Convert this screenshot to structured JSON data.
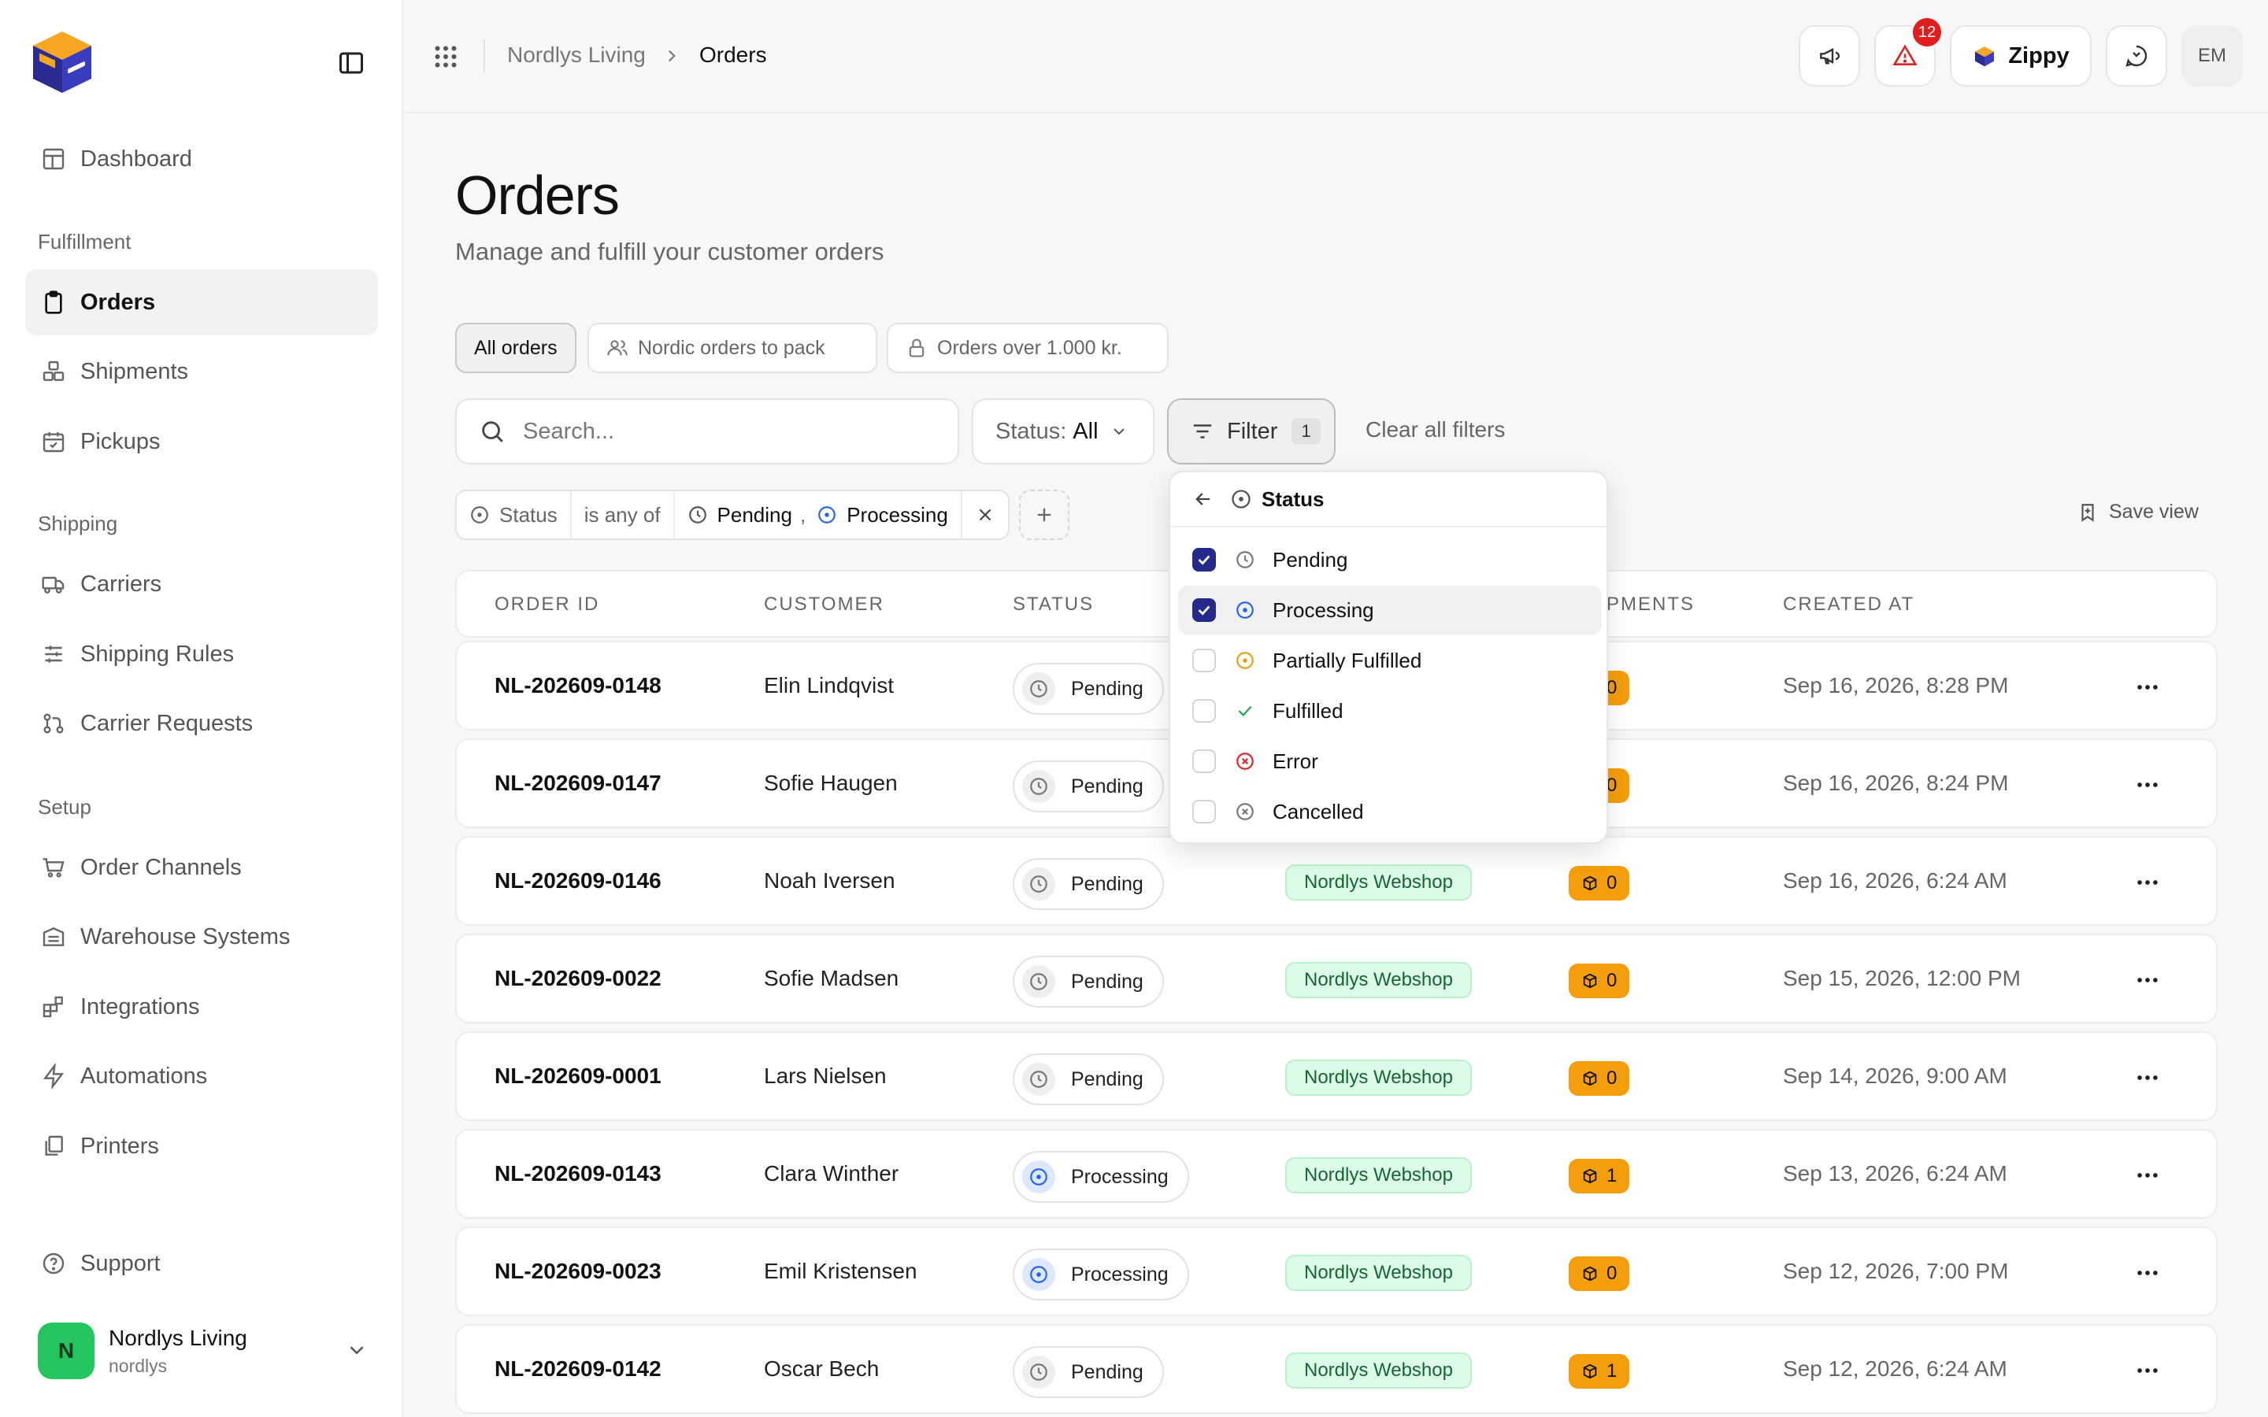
{
  "sidebar": {
    "items": [
      {
        "label": "Dashboard",
        "icon": "dashboard-icon"
      },
      {
        "label": "Orders",
        "icon": "clipboard-icon",
        "active": true
      },
      {
        "label": "Shipments",
        "icon": "boxes-icon"
      },
      {
        "label": "Pickups",
        "icon": "calendar-check-icon"
      },
      {
        "label": "Carriers",
        "icon": "truck-icon"
      },
      {
        "label": "Shipping Rules",
        "icon": "sliders-icon"
      },
      {
        "label": "Carrier Requests",
        "icon": "git-pull-icon"
      },
      {
        "label": "Order Channels",
        "icon": "cart-icon"
      },
      {
        "label": "Warehouse Systems",
        "icon": "warehouse-icon"
      },
      {
        "label": "Integrations",
        "icon": "blocks-icon"
      },
      {
        "label": "Automations",
        "icon": "zap-icon"
      },
      {
        "label": "Printers",
        "icon": "copy-icon"
      },
      {
        "label": "Support",
        "icon": "help-circle-icon"
      }
    ],
    "sections": {
      "fulfillment": "Fulfillment",
      "shipping": "Shipping",
      "setup": "Setup"
    },
    "account": {
      "initial": "N",
      "name": "Nordlys Living",
      "handle": "nordlys"
    }
  },
  "topbar": {
    "breadcrumb": {
      "parent": "Nordlys Living",
      "current": "Orders"
    },
    "alerts_count": "12",
    "assistant_label": "Zippy",
    "user_initials": "EM"
  },
  "page": {
    "title": "Orders",
    "subtitle": "Manage and fulfill your customer orders"
  },
  "views": [
    {
      "label": "All orders",
      "active": true
    },
    {
      "label": "Nordic orders to pack",
      "icon": "users-icon"
    },
    {
      "label": "Orders over 1.000 kr.",
      "icon": "lock-icon"
    }
  ],
  "toolbar": {
    "search_placeholder": "Search...",
    "status_label": "Status:",
    "status_value": "All",
    "filter_label": "Filter",
    "filter_count": "1",
    "clear_label": "Clear all filters",
    "save_view_label": "Save view"
  },
  "active_filter": {
    "field": "Status",
    "operator": "is any of",
    "value1": "Pending",
    "separator": ",",
    "value2": "Processing"
  },
  "table": {
    "headers": {
      "order_id": "ORDER ID",
      "customer": "CUSTOMER",
      "status": "STATUS",
      "shipments": "PMENTS",
      "created_at": "CREATED AT"
    },
    "rows": [
      {
        "id": "NL-202609-0148",
        "customer": "Elin Lindqvist",
        "status": "Pending",
        "channel": "",
        "shipments": "0",
        "created": "Sep 16, 2026, 8:28 PM"
      },
      {
        "id": "NL-202609-0147",
        "customer": "Sofie Haugen",
        "status": "Pending",
        "channel": "",
        "shipments": "0",
        "created": "Sep 16, 2026, 8:24 PM"
      },
      {
        "id": "NL-202609-0146",
        "customer": "Noah Iversen",
        "status": "Pending",
        "channel": "Nordlys Webshop",
        "shipments": "0",
        "created": "Sep 16, 2026, 6:24 AM"
      },
      {
        "id": "NL-202609-0022",
        "customer": "Sofie Madsen",
        "status": "Pending",
        "channel": "Nordlys Webshop",
        "shipments": "0",
        "created": "Sep 15, 2026, 12:00 PM"
      },
      {
        "id": "NL-202609-0001",
        "customer": "Lars Nielsen",
        "status": "Pending",
        "channel": "Nordlys Webshop",
        "shipments": "0",
        "created": "Sep 14, 2026, 9:00 AM"
      },
      {
        "id": "NL-202609-0143",
        "customer": "Clara Winther",
        "status": "Processing",
        "channel": "Nordlys Webshop",
        "shipments": "1",
        "created": "Sep 13, 2026, 6:24 AM"
      },
      {
        "id": "NL-202609-0023",
        "customer": "Emil Kristensen",
        "status": "Processing",
        "channel": "Nordlys Webshop",
        "shipments": "0",
        "created": "Sep 12, 2026, 7:00 PM"
      },
      {
        "id": "NL-202609-0142",
        "customer": "Oscar Bech",
        "status": "Pending",
        "channel": "Nordlys Webshop",
        "shipments": "1",
        "created": "Sep 12, 2026, 6:24 AM"
      }
    ]
  },
  "dropdown": {
    "title": "Status",
    "options": [
      {
        "label": "Pending",
        "checked": true,
        "icon": "clock-icon",
        "color": "#777777"
      },
      {
        "label": "Processing",
        "checked": true,
        "icon": "circle-dot-icon",
        "color": "#2563eb"
      },
      {
        "label": "Partially Fulfilled",
        "checked": false,
        "icon": "circle-dot-icon",
        "color": "#e5a00d"
      },
      {
        "label": "Fulfilled",
        "checked": false,
        "icon": "check-icon",
        "color": "#16a34a"
      },
      {
        "label": "Error",
        "checked": false,
        "icon": "x-circle-icon",
        "color": "#dc2626"
      },
      {
        "label": "Cancelled",
        "checked": false,
        "icon": "x-circle-icon",
        "color": "#777777"
      }
    ]
  },
  "colors": {
    "accent": "#252a8a",
    "channel_bg": "#dcfce7",
    "shipment_badge": "#f59e0b",
    "alert_badge": "#e11d1d",
    "account_avatar": "#22c55e"
  }
}
